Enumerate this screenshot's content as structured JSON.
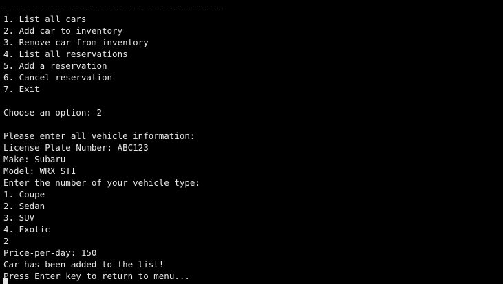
{
  "terminal": {
    "lines": [
      "-------------------------------------------",
      "1. List all cars",
      "2. Add car to inventory",
      "3. Remove car from inventory",
      "4. List all reservations",
      "5. Add a reservation",
      "6. Cancel reservation",
      "7. Exit",
      "",
      "Choose an option: 2",
      "",
      "Please enter all vehicle information:",
      "License Plate Number: ABC123",
      "Make: Subaru",
      "Model: WRX STI",
      "Enter the number of your vehicle type:",
      "1. Coupe",
      "2. Sedan",
      "3. SUV",
      "4. Exotic",
      "2",
      "Price-per-day: 150",
      "Car has been added to the list!",
      "Press Enter key to return to menu..."
    ]
  }
}
